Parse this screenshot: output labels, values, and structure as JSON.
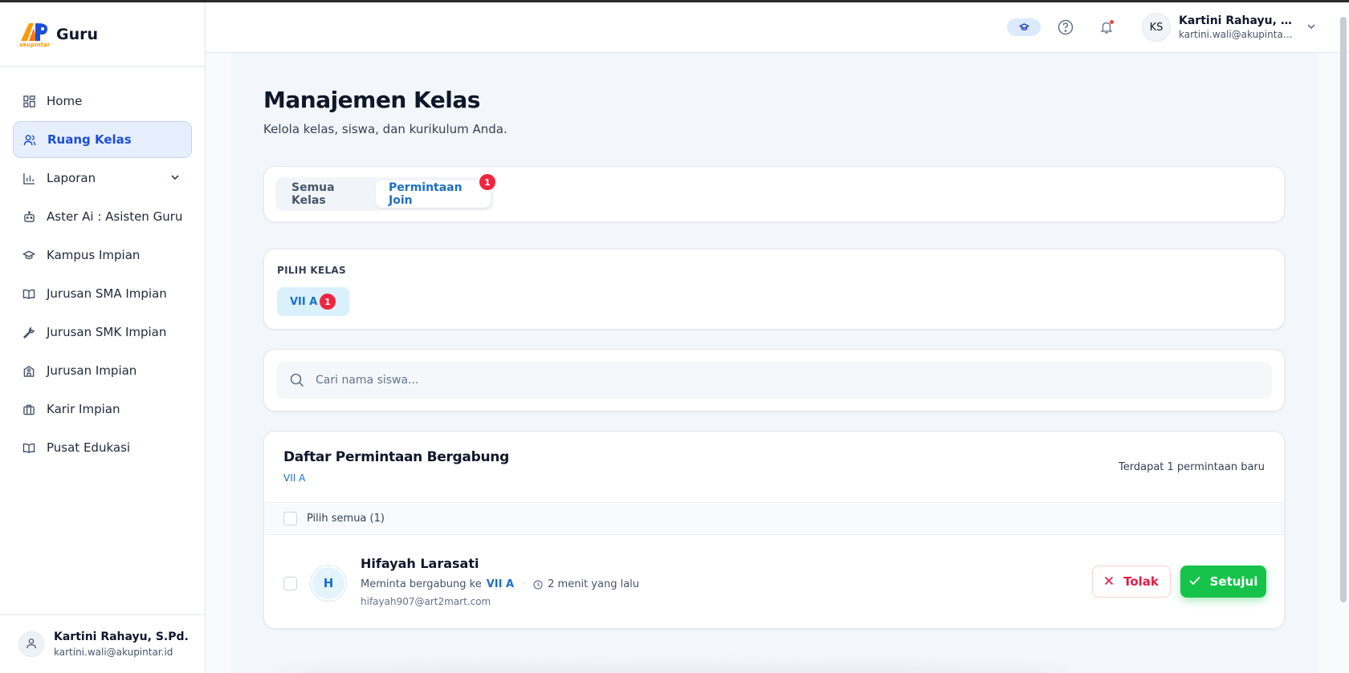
{
  "brand": {
    "name": "Guru",
    "logo_text": "akupintar"
  },
  "sidebar": {
    "items": [
      {
        "label": "Home",
        "icon": "grid-icon"
      },
      {
        "label": "Ruang Kelas",
        "icon": "users-icon"
      },
      {
        "label": "Laporan",
        "icon": "bar-chart-icon"
      },
      {
        "label": "Aster Ai : Asisten Guru",
        "icon": "robot-icon"
      },
      {
        "label": "Kampus Impian",
        "icon": "graduation-cap-icon"
      },
      {
        "label": "Jurusan SMA Impian",
        "icon": "book-icon"
      },
      {
        "label": "Jurusan SMK Impian",
        "icon": "wrench-icon"
      },
      {
        "label": "Jurusan Impian",
        "icon": "school-icon"
      },
      {
        "label": "Karir Impian",
        "icon": "briefcase-icon"
      },
      {
        "label": "Pusat Edukasi",
        "icon": "book-icon"
      }
    ],
    "user": {
      "name": "Kartini Rahayu, S.Pd.",
      "email": "kartini.wali@akupintar.id"
    }
  },
  "topbar": {
    "avatar_initials": "KS",
    "user_name": "Kartini Rahayu, S.Pd.",
    "user_email": "kartini.wali@akupintar.id"
  },
  "page": {
    "title": "Manajemen Kelas",
    "subtitle": "Kelola kelas, siswa, dan kurikulum Anda."
  },
  "tabs": {
    "all": "Semua Kelas",
    "requests": "Permintaan Join",
    "requests_badge": "1"
  },
  "class_picker": {
    "label": "PILIH KELAS",
    "selected": "VII A",
    "badge": "1"
  },
  "search": {
    "placeholder": "Cari nama siswa..."
  },
  "request_list": {
    "title": "Daftar Permintaan Bergabung",
    "class": "VII A",
    "count_text": "Terdapat 1 permintaan baru",
    "select_all": "Pilih semua (1)",
    "items": [
      {
        "initial": "H",
        "name": "Hifayah Larasati",
        "meta_prefix": "Meminta bergabung ke",
        "class": "VII A",
        "time": "2 menit yang lalu",
        "email": "hifayah907@art2mart.com"
      }
    ],
    "reject_label": "Tolak",
    "approve_label": "Setujui"
  },
  "colors": {
    "accent": "#1d6fc4",
    "active_nav_bg": "#e7efff",
    "badge": "#ef2540",
    "approve": "#16c34a",
    "reject": "#e11d48"
  }
}
